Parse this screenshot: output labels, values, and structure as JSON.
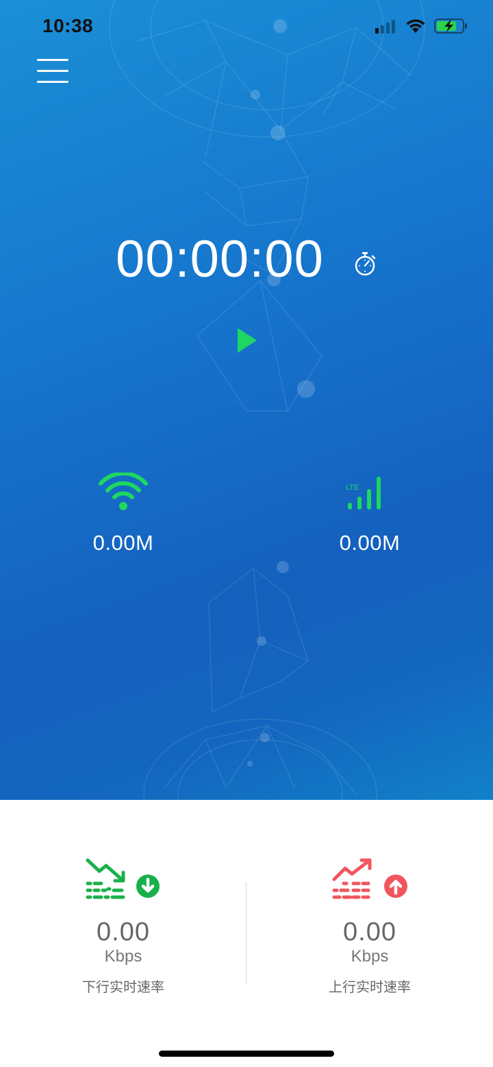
{
  "status_bar": {
    "time": "10:38",
    "icons": [
      "cellular-signal-icon",
      "wifi-icon",
      "battery-charging-icon"
    ]
  },
  "menu": {
    "icon": "hamburger-menu-icon"
  },
  "timer": {
    "value": "00:00:00",
    "icon": "stopwatch-icon"
  },
  "play": {
    "icon": "play-icon",
    "color": "#1ed760"
  },
  "network": {
    "wifi": {
      "icon": "wifi-icon",
      "value": "0.00M",
      "color": "#1ed760"
    },
    "cellular": {
      "icon": "lte-signal-icon",
      "badge": "LTE",
      "value": "0.00M",
      "color": "#1ed760"
    }
  },
  "speeds": {
    "download": {
      "icon": "downtrend-icon",
      "badge_icon": "arrow-down-circle-icon",
      "value": "0.00",
      "unit": "Kbps",
      "label": "下行实时速率",
      "color": "#19b04a"
    },
    "upload": {
      "icon": "uptrend-icon",
      "badge_icon": "arrow-up-circle-icon",
      "value": "0.00",
      "unit": "Kbps",
      "label": "上行实时速率",
      "color": "#f0565e"
    }
  },
  "colors": {
    "hero_top": "#1a8fd6",
    "hero_bottom": "#1460bd",
    "accent_green": "#1ed760",
    "upload_red": "#f0565e"
  }
}
